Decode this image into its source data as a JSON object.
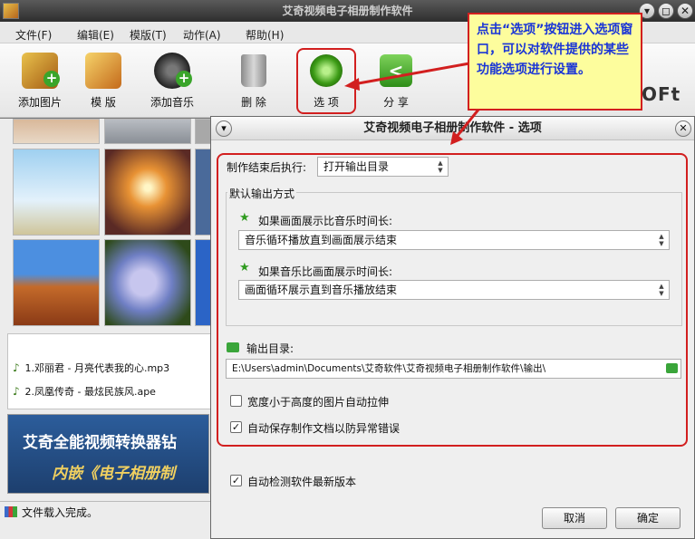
{
  "window": {
    "title": "艾奇视频电子相册制作软件",
    "min_glyph": "▾",
    "max_glyph": "◻",
    "close_glyph": "✕"
  },
  "menu": [
    "文件(F)",
    "编辑(E)",
    "模版(T)",
    "动作(A)",
    "帮助(H)"
  ],
  "toolbar": {
    "add_image": "添加图片",
    "template": "模 版",
    "add_music": "添加音乐",
    "delete": "删 除",
    "options": "选 项",
    "share": "分 享",
    "brand_partial": "OFt"
  },
  "songs": [
    "1.邓丽君 - 月亮代表我的心.mp3",
    "2.凤凰传奇 - 最炫民族风.ape"
  ],
  "banner": {
    "line1": "艾奇全能视频转换器钻",
    "line2": "内嵌《电子相册制"
  },
  "status": "文件载入完成。",
  "dialog": {
    "title": "艾奇视频电子相册制作软件 - 选项",
    "after_label": "制作结束后执行:",
    "after_value": "打开输出目录",
    "group_label": "默认输出方式",
    "if_image_longer": "如果画面展示比音乐时间长:",
    "image_longer_value": "音乐循环播放直到画面展示结束",
    "if_music_longer": "如果音乐比画面展示时间长:",
    "music_longer_value": "画面循环展示直到音乐播放结束",
    "output_dir_label": "输出目录:",
    "output_dir_value": "E:\\Users\\admin\\Documents\\艾奇软件\\艾奇视频电子相册制作软件\\输出\\",
    "stretch_label": "宽度小于高度的图片自动拉伸",
    "stretch_checked": false,
    "autosave_label": "自动保存制作文档以防异常错误",
    "autosave_checked": true,
    "autocheck_label": "自动检测软件最新版本",
    "autocheck_checked": true,
    "cancel": "取消",
    "ok": "确定"
  },
  "callout": {
    "text": "点击“选项”按钮进入选项窗口，可以对软件提供的某些功能选项进行设置。"
  },
  "colors": {
    "highlight_red": "#d21f1f",
    "callout_bg": "#fdfd9d",
    "callout_text": "#1a35d6"
  },
  "icons": [
    "add-image-icon",
    "template-icon",
    "add-music-icon",
    "recycle-bin-icon",
    "gear-icon",
    "share-icon",
    "star-icon",
    "folder-icon",
    "music-note-icon"
  ]
}
